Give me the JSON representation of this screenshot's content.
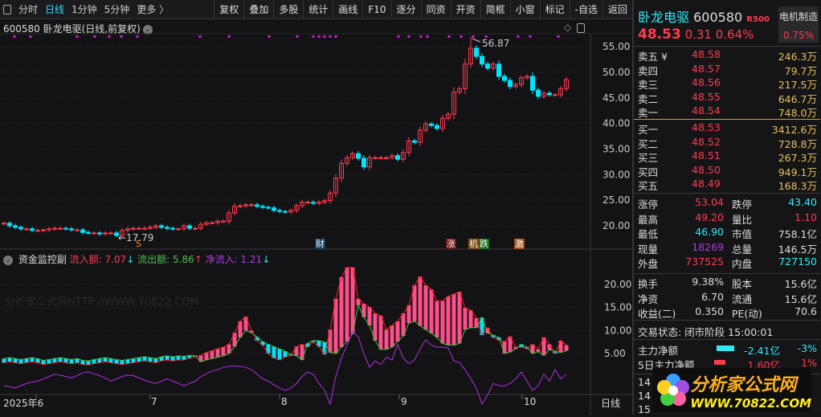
{
  "toolbar": {
    "left": [
      "分时",
      "日线",
      "1分钟",
      "5分钟",
      "更多 〉"
    ],
    "active": "日线",
    "buttons": [
      "复权",
      "叠加",
      "多股",
      "统计",
      "画线",
      "F10",
      "逐分",
      "同资",
      "开资",
      "简框",
      "小窗",
      "标记",
      "-自选",
      "返回"
    ]
  },
  "chart": {
    "title": "600580 卧龙电驱(日线,前复权)",
    "price_ticks": [
      "55.00",
      "50.00",
      "45.00",
      "40.00",
      "35.00",
      "30.00",
      "25.00",
      "20.00"
    ],
    "high_label": "56.87",
    "low_label": "←17.79",
    "signals": [
      "S",
      "财",
      "涨",
      "机",
      "跌",
      "激"
    ]
  },
  "indicator": {
    "name": "资金监控副",
    "inflow_label": "流入额: 7.07",
    "outflow_label": "流出额: 5.86",
    "net_label": "净流入: 1.21",
    "ticks": [
      "20.00",
      "15.00",
      "10.00",
      "5.00"
    ],
    "watermark": "分析家公式网HTTP://WWW.70822.COM"
  },
  "date_axis": {
    "labels": [
      "2025年6",
      "7",
      "8",
      "9",
      "10"
    ],
    "period": "日线"
  },
  "colors": {
    "up": "#ff3b50",
    "down": "#00e5ff",
    "bar_up": "#ff4f8a",
    "inflow_line": "#ff2020",
    "outflow_line": "#40c040",
    "net_line": "#b030e0",
    "marker": "#d020d0"
  },
  "chart_data": {
    "type": "candlestick",
    "ylim": [
      17,
      58
    ],
    "close": [
      20.5,
      20.0,
      19.7,
      19.4,
      19.4,
      19.1,
      19.1,
      19.2,
      19.4,
      19.5,
      19.5,
      19.4,
      19.2,
      19.2,
      18.7,
      18.6,
      18.6,
      18.4,
      18.6,
      18.6,
      18.1,
      19.1,
      19.4,
      19.5,
      19.5,
      19.5,
      19.7,
      20.0,
      19.7,
      19.5,
      19.4,
      19.4,
      20.0,
      19.5,
      19.5,
      20.3,
      20.6,
      20.6,
      20.9,
      20.9,
      22.5,
      23.8,
      23.9,
      24.1,
      24.1,
      23.8,
      23.6,
      23.5,
      23.0,
      22.8,
      22.7,
      23.0,
      23.9,
      24.6,
      24.6,
      24.4,
      24.6,
      24.9,
      26.4,
      29.3,
      32.2,
      33.3,
      34.1,
      33.2,
      31.5,
      33.3,
      33.3,
      33.3,
      33.3,
      33.7,
      33.0,
      34.3,
      36.6,
      36.3,
      38.7,
      39.9,
      39.6,
      39.0,
      41.0,
      41.8,
      46.1,
      46.8,
      51.6,
      54.7,
      53.1,
      51.6,
      50.8,
      51.6,
      49.2,
      48.4,
      47.2,
      47.6,
      48.9,
      49.2,
      46.5,
      45.3,
      45.9,
      45.6,
      45.6,
      46.8,
      48.53
    ],
    "max": 56.87,
    "min": 17.79,
    "flow": {
      "ylim": [
        -7,
        24
      ],
      "inflow": [
        3,
        3.2,
        3,
        2.8,
        3,
        3.2,
        3,
        2.6,
        2.8,
        3,
        3.2,
        3,
        2.8,
        3,
        2.6,
        2.5,
        2.8,
        3,
        3.2,
        3,
        2.8,
        2.6,
        2.8,
        3,
        3.2,
        3.4,
        3.2,
        3,
        3.4,
        3.6,
        3.4,
        3.6,
        3.6,
        4.0,
        4.3,
        4.6,
        5.2,
        5.6,
        6.0,
        6.4,
        7.0,
        9.5,
        12.0,
        13.0,
        10.0,
        7.8,
        6.8,
        5.0,
        4.0,
        3.6,
        4.2,
        4.6,
        6.5,
        7.0,
        6.4,
        7.5,
        6.5,
        4.8,
        10.2,
        16.9,
        21.6,
        23.7,
        23.7,
        16.9,
        15.8,
        15.1,
        13.7,
        13.2,
        10.2,
        11.1,
        12.0,
        13.7,
        15.5,
        19.8,
        21.7,
        19.8,
        18.9,
        16.4,
        16.4,
        17.4,
        17.9,
        18.4,
        14.9,
        14.4,
        12.7,
        9.0,
        10.6,
        8.5,
        7.9,
        7.6,
        8.7,
        6.4,
        6.4,
        6.0,
        7.0,
        5.9,
        8.5,
        7.0,
        5.0,
        7.8,
        6.8
      ],
      "outflow": [
        3.9,
        4.1,
        3.9,
        3.7,
        3.9,
        4.1,
        3.9,
        3.5,
        3.7,
        3.9,
        4.1,
        3.9,
        3.7,
        3.9,
        3.5,
        3.4,
        3.7,
        3.9,
        4.1,
        3.9,
        3.7,
        3.5,
        3.7,
        3.9,
        4.1,
        4.3,
        4.1,
        3.9,
        4.3,
        4.5,
        4.3,
        4.5,
        4.4,
        4.6,
        4.5,
        3.2,
        3.6,
        3.9,
        4.2,
        4.5,
        5.0,
        6.5,
        8.5,
        10.0,
        9.5,
        8.6,
        7.6,
        7.0,
        6.5,
        6.0,
        5.5,
        4.8,
        4.5,
        3.6,
        7.2,
        7.8,
        7.8,
        7.5,
        5.2,
        5.0,
        6.4,
        7.6,
        9.3,
        15.5,
        12.9,
        11.1,
        7.8,
        5.9,
        5.9,
        6.4,
        7.6,
        8.8,
        11.6,
        12.0,
        11.0,
        10.2,
        9.4,
        8.5,
        7.2,
        6.8,
        6.8,
        7.2,
        10.2,
        10.6,
        10.6,
        12.8,
        9.4,
        9.0,
        8.5,
        5.0,
        5.3,
        6.0,
        7.0,
        6.4,
        5.0,
        5.4,
        4.6,
        5.8,
        5.5,
        5.2,
        5.6
      ],
      "net": [
        -2,
        -2.2,
        -2.5,
        -2,
        -1.5,
        -1.2,
        -1,
        -0.5,
        0,
        0.5,
        0.3,
        0,
        -0.3,
        0.2,
        0.8,
        1,
        0.6,
        0.2,
        -0.3,
        -1,
        -0.5,
        0,
        0.3,
        0.2,
        -0.3,
        -0.8,
        -1.2,
        -1.5,
        -1,
        -0.5,
        -1,
        -1.5,
        -2,
        -1.5,
        -1,
        0,
        0.6,
        1.2,
        1.5,
        2,
        2.2,
        2.3,
        2.2,
        2,
        1.5,
        0.5,
        -0.5,
        -1,
        -1.8,
        -2.5,
        -3,
        -2.5,
        -1.5,
        0,
        1,
        0.5,
        -1.5,
        -3,
        -6,
        0,
        4,
        6.8,
        9.8,
        8.6,
        5,
        2,
        3.4,
        2.6,
        4.2,
        3.6,
        7,
        4,
        2.8,
        3.6,
        6,
        8,
        6.8,
        6.4,
        6.4,
        6.2,
        3.4,
        3,
        1.5,
        -0.5,
        -2.5,
        -6,
        -4,
        -1.5,
        -2,
        -2,
        -1.5,
        -0.5,
        1,
        -1,
        -3,
        -2,
        0.5,
        -1,
        1.5,
        -0.5,
        0.5
      ]
    }
  },
  "quote": {
    "name": "卧龙电驱",
    "code": "600580",
    "badge": "R500",
    "price": "48.53",
    "change": "0.31",
    "pct": "0.64%",
    "sector": "电机制造",
    "sector_pct": "0.75%",
    "asks": [
      [
        "卖五 ¥",
        "48.58",
        "246.3万"
      ],
      [
        "卖四",
        "48.57",
        "79.7万"
      ],
      [
        "卖三",
        "48.56",
        "217.5万"
      ],
      [
        "卖二",
        "48.55",
        "646.7万"
      ],
      [
        "卖一",
        "48.54",
        "748.0万"
      ]
    ],
    "bids": [
      [
        "买一",
        "48.53",
        "3412.6万"
      ],
      [
        "买二",
        "48.52",
        "728.8万"
      ],
      [
        "买三",
        "48.51",
        "267.3万"
      ],
      [
        "买四",
        "48.50",
        "949.1万"
      ],
      [
        "买五",
        "48.49",
        "168.3万"
      ]
    ],
    "stats1": [
      [
        "涨停",
        "53.04",
        "跌停",
        "43.40"
      ],
      [
        "最高",
        "49.20",
        "量比",
        "1.10"
      ],
      [
        "最低",
        "46.90",
        "市值",
        "758.1亿"
      ],
      [
        "现量",
        "18269",
        "总量",
        "146.5万"
      ],
      [
        "外盘",
        "737525",
        "内盘",
        "727150"
      ]
    ],
    "stats2": [
      [
        "换手",
        "9.38%",
        "股本",
        "15.6亿"
      ],
      [
        "净资",
        "6.70",
        "流通",
        "15.6亿"
      ],
      [
        "收益(二)",
        "0.350",
        "PE(动)",
        "70.6"
      ]
    ],
    "status": "交易状态: 闭市阶段 15:00:01",
    "flows": [
      [
        "主力净额",
        "-2.41亿",
        "-3%"
      ],
      [
        "5日主力净额",
        "1.60亿",
        "1%"
      ]
    ],
    "ticks": [
      "14",
      "14",
      "15"
    ],
    "logo": {
      "t1": "分析家公式网",
      "t2": "WWW.70822.COM"
    }
  }
}
